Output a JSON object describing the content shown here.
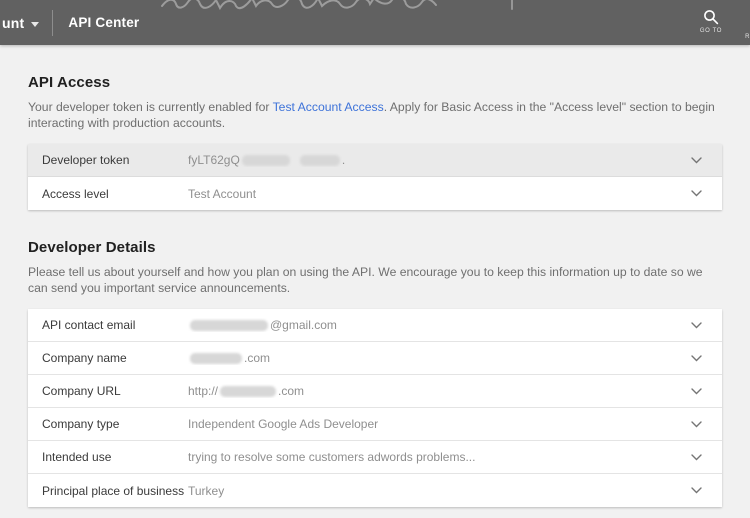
{
  "header": {
    "account_label": "unt",
    "title": "API Center",
    "goto_label": "GO TO",
    "right_partial": "R"
  },
  "colors": {
    "topbar_bg": "#616161",
    "page_bg": "#f1f1f1",
    "link_blue": "#3e73d9",
    "shaded_row": "#eaeaea"
  },
  "api_access": {
    "heading": "API Access",
    "desc_before_link": "Your developer token is currently enabled for ",
    "link_text": "Test Account Access",
    "desc_after_link": ". Apply for Basic Access in the \"Access level\" section to begin interacting with production accounts.",
    "rows": [
      {
        "label": "Developer token",
        "value_prefix": "fyLT62gQ",
        "value_suffix": "."
      },
      {
        "label": "Access level",
        "value": "Test Account"
      }
    ]
  },
  "developer_details": {
    "heading": "Developer Details",
    "description": "Please tell us about yourself and how you plan on using the API. We encourage you to keep this information up to date so we can send you important service announcements.",
    "rows": [
      {
        "label": "API contact email",
        "value_prefix": "",
        "value_suffix": "@gmail.com"
      },
      {
        "label": "Company name",
        "value_prefix": "",
        "value_suffix": ".com"
      },
      {
        "label": "Company URL",
        "value_prefix": "http://",
        "value_suffix": ".com"
      },
      {
        "label": "Company type",
        "value": "Independent Google Ads Developer"
      },
      {
        "label": "Intended use",
        "value": "trying to resolve some customers adwords problems..."
      },
      {
        "label": "Principal place of business",
        "value": "Turkey"
      }
    ]
  }
}
